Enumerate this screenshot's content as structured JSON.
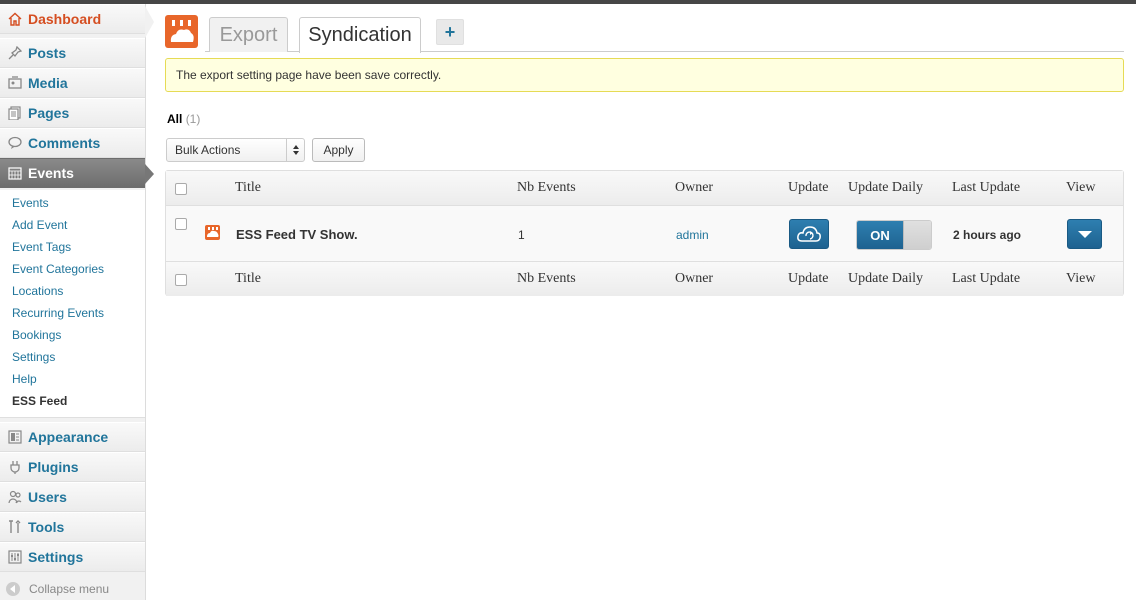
{
  "sidebar": {
    "items": [
      {
        "label": "Dashboard",
        "icon": "home-icon"
      },
      {
        "label": "Posts",
        "icon": "pin-icon"
      },
      {
        "label": "Media",
        "icon": "media-icon"
      },
      {
        "label": "Pages",
        "icon": "pages-icon"
      },
      {
        "label": "Comments",
        "icon": "comment-icon"
      },
      {
        "label": "Events",
        "icon": "calendar-icon"
      },
      {
        "label": "Appearance",
        "icon": "appearance-icon"
      },
      {
        "label": "Plugins",
        "icon": "plug-icon"
      },
      {
        "label": "Users",
        "icon": "users-icon"
      },
      {
        "label": "Tools",
        "icon": "tools-icon"
      },
      {
        "label": "Settings",
        "icon": "settings-icon"
      }
    ],
    "submenu": [
      "Events",
      "Add Event",
      "Event Tags",
      "Event Categories",
      "Locations",
      "Recurring Events",
      "Bookings",
      "Settings",
      "Help",
      "ESS Feed"
    ],
    "collapse_label": "Collapse menu"
  },
  "tabs": {
    "export": "Export",
    "syndication": "Syndication",
    "add": "+"
  },
  "notice": "The export setting page have been save correctly.",
  "filter": {
    "all": "All",
    "count": "(1)"
  },
  "bulk": {
    "selected": "Bulk Actions",
    "apply": "Apply"
  },
  "table": {
    "headers": [
      "Title",
      "Nb Events",
      "Owner",
      "Update",
      "Update Daily",
      "Last Update",
      "View"
    ],
    "rows": [
      {
        "title": "ESS Feed TV Show.",
        "nb_events": "1",
        "owner": "admin",
        "toggle": "ON",
        "last_update": "2 hours ago"
      }
    ]
  },
  "colors": {
    "accent": "#21759b",
    "brand_orange": "#e8662a",
    "active_menu": "#777777"
  }
}
